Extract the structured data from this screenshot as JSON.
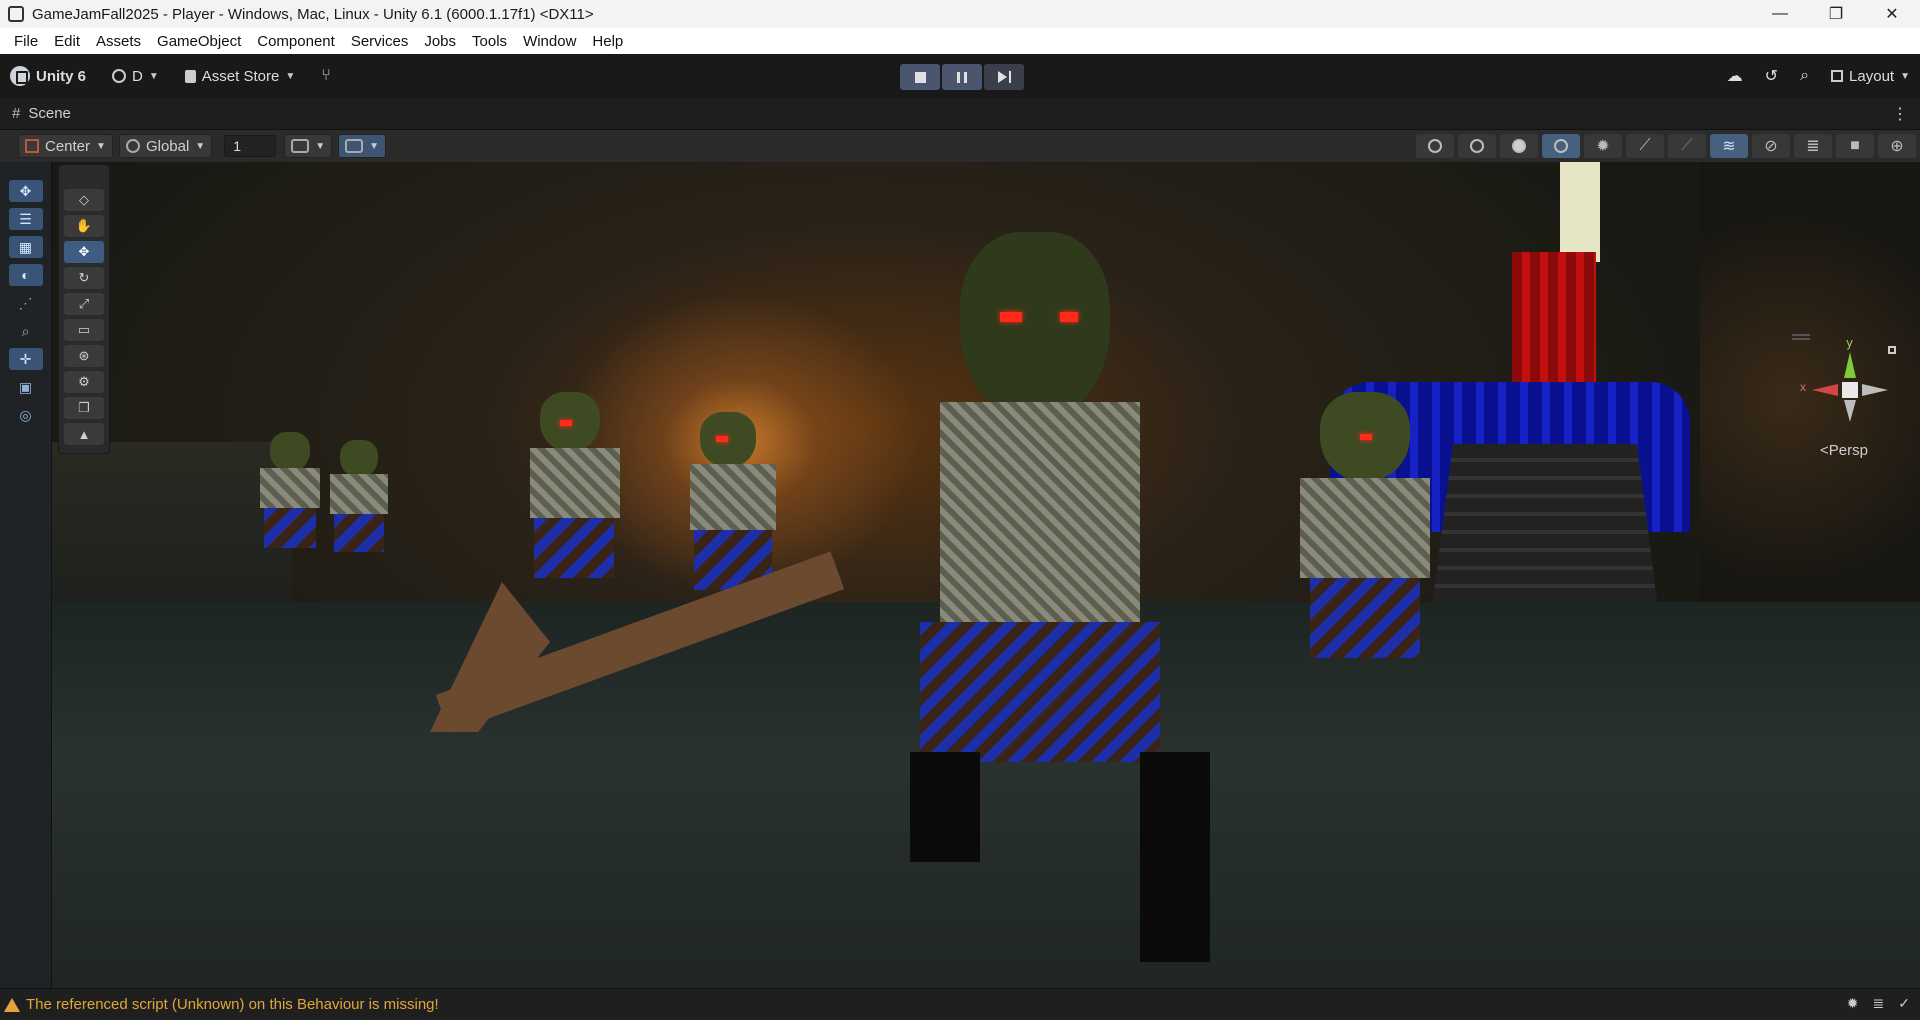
{
  "window": {
    "title": "GameJamFall2025 - Player - Windows, Mac, Linux - Unity 6.1 (6000.1.17f1) <DX11>",
    "controls": [
      "—",
      "❐",
      "✕"
    ]
  },
  "menubar": [
    "File",
    "Edit",
    "Assets",
    "GameObject",
    "Component",
    "Services",
    "Jobs",
    "Tools",
    "Window",
    "Help"
  ],
  "toolbar": {
    "brand": "Unity 6",
    "account": "D",
    "asset_store": "Asset Store",
    "layout": "Layout"
  },
  "scene_tab": {
    "label": "Scene"
  },
  "scene_toolbar": {
    "pivot": "Center",
    "space": "Global",
    "grid_snap_value": "1"
  },
  "gizmo": {
    "y_label": "y",
    "x_label": "x",
    "projection": "Persp"
  },
  "status": {
    "message": "The referenced script (Unknown) on this Behaviour is missing!",
    "level_color": "#e0a63a"
  },
  "icons": {
    "left_tools": [
      "move-icon",
      "transform-icon",
      "grid-icon",
      "sphere-icon",
      "nodes-icon",
      "zoom-icon",
      "move-axes-icon",
      "camera-icon",
      "compass-icon"
    ],
    "overlay_tools": [
      "view-cube-icon",
      "hand-icon",
      "move-icon",
      "rotate-icon",
      "scale-icon",
      "rect-icon",
      "transform-icon",
      "custom-tool-icon",
      "duplicate-icon",
      "terrain-icon"
    ]
  }
}
